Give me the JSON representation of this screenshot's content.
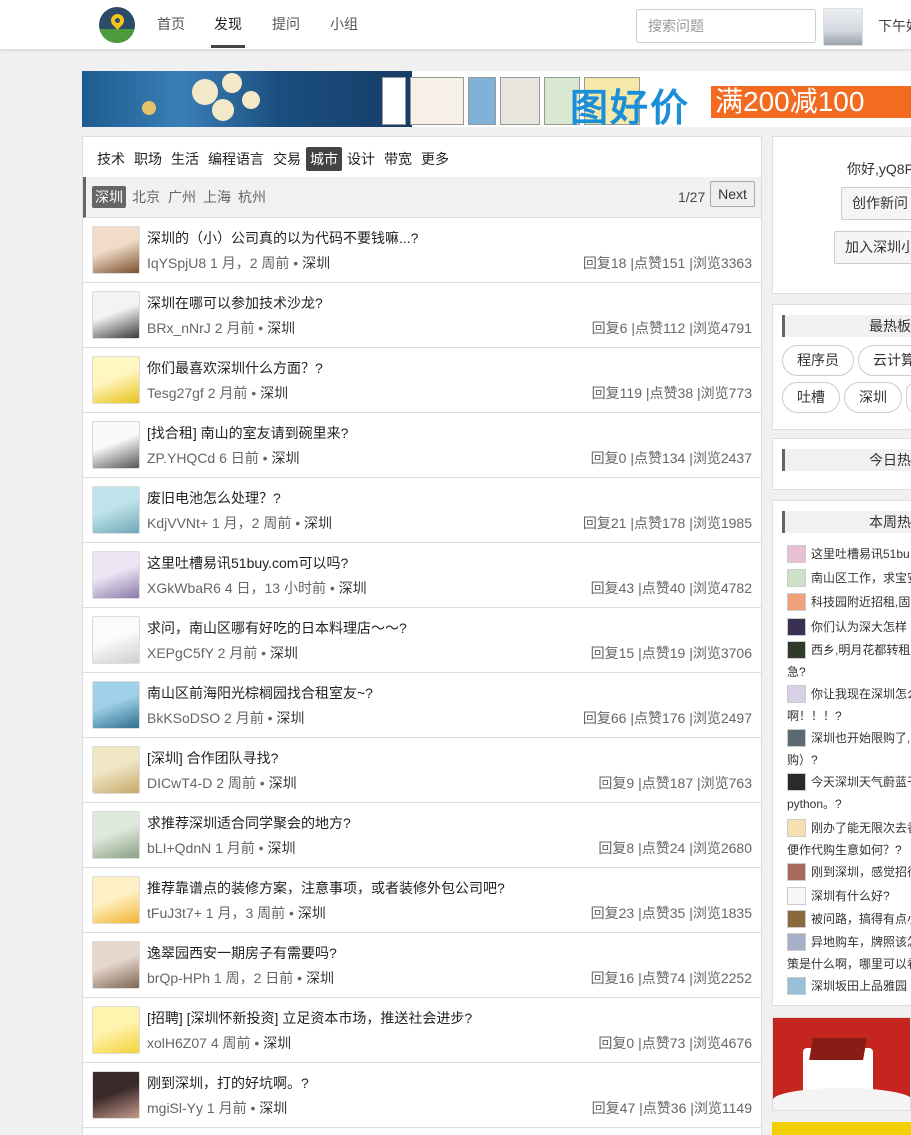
{
  "nav": {
    "items": [
      "首页",
      "发现",
      "提问",
      "小组"
    ],
    "active_index": 1
  },
  "search": {
    "placeholder": "搜索问题"
  },
  "clock": "下午好",
  "banner": {
    "slogan": "图好价",
    "promo": "满200减100"
  },
  "categories": {
    "items": [
      "技术",
      "职场",
      "生活",
      "编程语言",
      "交易",
      "城市",
      "设计",
      "带宽",
      "更多"
    ],
    "active": "城市"
  },
  "subcategories": {
    "items": [
      "深圳",
      "北京",
      "广州",
      "上海",
      "杭州"
    ],
    "active": "深圳"
  },
  "pager": {
    "text": "1/27",
    "next_label": "Next"
  },
  "topics": [
    {
      "title": "深圳的（小）公司真的以为代码不要钱嘛...?",
      "user": "IqYSpjU8",
      "time": "1 月，2 周前",
      "tag": "深圳",
      "replies": "回复18",
      "likes": "|点赞151",
      "views": "|浏览3363"
    },
    {
      "title": "深圳在哪可以参加技术沙龙?",
      "user": "BRx_nNrJ",
      "time": "2 月前",
      "tag": "深圳",
      "replies": "回复6",
      "likes": "|点赞112",
      "views": "|浏览4791"
    },
    {
      "title": "你们最喜欢深圳什么方面？?",
      "user": "Tesg27gf",
      "time": "2 月前",
      "tag": "深圳",
      "replies": "回复119",
      "likes": "|点赞38",
      "views": "|浏览773"
    },
    {
      "title": "[找合租] 南山的室友请到碗里来?",
      "user": "ZP.YHQCd",
      "time": "6 日前",
      "tag": "深圳",
      "replies": "回复0",
      "likes": "|点赞134",
      "views": "|浏览2437"
    },
    {
      "title": "废旧电池怎么处理？?",
      "user": "KdjVVNt+",
      "time": "1 月，2 周前",
      "tag": "深圳",
      "replies": "回复21",
      "likes": "|点赞178",
      "views": "|浏览1985"
    },
    {
      "title": "这里吐槽易讯51buy.com可以吗?",
      "user": "XGkWbaR6",
      "time": "4 日，13 小时前",
      "tag": "深圳",
      "replies": "回复43",
      "likes": "|点赞40",
      "views": "|浏览4782"
    },
    {
      "title": "求问，南山区哪有好吃的日本料理店～～?",
      "user": "XEPgC5fY",
      "time": "2 月前",
      "tag": "深圳",
      "replies": "回复15",
      "likes": "|点赞19",
      "views": "|浏览3706"
    },
    {
      "title": "南山区前海阳光棕榈园找合租室友~?",
      "user": "BkKSoDSO",
      "time": "2 月前",
      "tag": "深圳",
      "replies": "回复66",
      "likes": "|点赞176",
      "views": "|浏览2497"
    },
    {
      "title": "[深圳] 合作团队寻找?",
      "user": "DICwT4-D",
      "time": "2 周前",
      "tag": "深圳",
      "replies": "回复9",
      "likes": "|点赞187",
      "views": "|浏览763"
    },
    {
      "title": "求推荐深圳适合同学聚会的地方?",
      "user": "bLI+QdnN",
      "time": "1 月前",
      "tag": "深圳",
      "replies": "回复8",
      "likes": "|点赞24",
      "views": "|浏览2680"
    },
    {
      "title": "推荐靠谱点的装修方案，注意事项，或者装修外包公司吧?",
      "user": "tFuJ3t7+",
      "time": "1 月，3 周前",
      "tag": "深圳",
      "replies": "回复23",
      "likes": "|点赞35",
      "views": "|浏览1835"
    },
    {
      "title": "逸翠园西安一期房子有需要吗?",
      "user": "brQp-HPh",
      "time": "1 周，2 日前",
      "tag": "深圳",
      "replies": "回复16",
      "likes": "|点赞74",
      "views": "|浏览2252"
    },
    {
      "title": "[招聘] [深圳怀新投资] 立足资本市场，推送社会进步?",
      "user": "xolH6Z07",
      "time": "4 周前",
      "tag": "深圳",
      "replies": "回复0",
      "likes": "|点赞73",
      "views": "|浏览4676"
    },
    {
      "title": "刚到深圳，打的好坑啊。?",
      "user": "mgiSl-Yy",
      "time": "1 月前",
      "tag": "深圳",
      "replies": "回复47",
      "likes": "|点赞36",
      "views": "|浏览1149"
    }
  ],
  "side": {
    "greeting": "你好,yQ8F",
    "create_btn": "创作新问",
    "join_btn": "加入深圳小",
    "hot_boards_title": "最热板",
    "hot_boards": [
      "程序员",
      "云计算",
      "吐槽",
      "深圳"
    ],
    "today_hot_title": "今日热",
    "week_hot_title": "本周热",
    "week_hot": [
      {
        "line1": "这里吐槽易讯51bu",
        "line2": ""
      },
      {
        "line1": "南山区工作，求宝安",
        "line2": ""
      },
      {
        "line1": "科技园附近招租,固定",
        "line2": ""
      },
      {
        "line1": "你们认为深大怎样",
        "line2": ""
      },
      {
        "line1": "西乡,明月花都转租",
        "line2": "急?"
      },
      {
        "line1": "你让我现在深圳怎么",
        "line2": "啊！！！?"
      },
      {
        "line1": "深圳也开始限购了,",
        "line2": "购）?"
      },
      {
        "line1": "今天深圳天气蔚蓝干",
        "line2": "python。?"
      },
      {
        "line1": "刚办了能无限次去香",
        "line2": "便作代购生意如何？?"
      },
      {
        "line1": "刚到深圳，感觉招待",
        "line2": ""
      },
      {
        "line1": "深圳有什么好?",
        "line2": ""
      },
      {
        "line1": "被问路，搞得有点小",
        "line2": ""
      },
      {
        "line1": "异地购车，牌照该怎",
        "line2": "策是什么啊，哪里可以看"
      },
      {
        "line1": "深圳坂田上品雅园",
        "line2": ""
      }
    ]
  },
  "colors": {
    "accent": "#444444",
    "brand_blue": "#1a8fd8",
    "promo_orange": "#f26b21"
  }
}
